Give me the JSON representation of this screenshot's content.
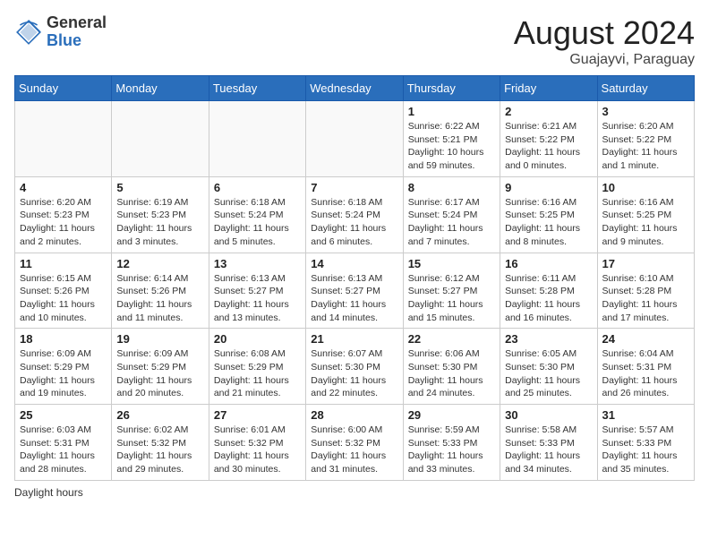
{
  "header": {
    "logo_general": "General",
    "logo_blue": "Blue",
    "month_year": "August 2024",
    "location": "Guajayvi, Paraguay"
  },
  "days_of_week": [
    "Sunday",
    "Monday",
    "Tuesday",
    "Wednesday",
    "Thursday",
    "Friday",
    "Saturday"
  ],
  "weeks": [
    [
      {
        "day": "",
        "info": ""
      },
      {
        "day": "",
        "info": ""
      },
      {
        "day": "",
        "info": ""
      },
      {
        "day": "",
        "info": ""
      },
      {
        "day": "1",
        "info": "Sunrise: 6:22 AM\nSunset: 5:21 PM\nDaylight: 10 hours and 59 minutes."
      },
      {
        "day": "2",
        "info": "Sunrise: 6:21 AM\nSunset: 5:22 PM\nDaylight: 11 hours and 0 minutes."
      },
      {
        "day": "3",
        "info": "Sunrise: 6:20 AM\nSunset: 5:22 PM\nDaylight: 11 hours and 1 minute."
      }
    ],
    [
      {
        "day": "4",
        "info": "Sunrise: 6:20 AM\nSunset: 5:23 PM\nDaylight: 11 hours and 2 minutes."
      },
      {
        "day": "5",
        "info": "Sunrise: 6:19 AM\nSunset: 5:23 PM\nDaylight: 11 hours and 3 minutes."
      },
      {
        "day": "6",
        "info": "Sunrise: 6:18 AM\nSunset: 5:24 PM\nDaylight: 11 hours and 5 minutes."
      },
      {
        "day": "7",
        "info": "Sunrise: 6:18 AM\nSunset: 5:24 PM\nDaylight: 11 hours and 6 minutes."
      },
      {
        "day": "8",
        "info": "Sunrise: 6:17 AM\nSunset: 5:24 PM\nDaylight: 11 hours and 7 minutes."
      },
      {
        "day": "9",
        "info": "Sunrise: 6:16 AM\nSunset: 5:25 PM\nDaylight: 11 hours and 8 minutes."
      },
      {
        "day": "10",
        "info": "Sunrise: 6:16 AM\nSunset: 5:25 PM\nDaylight: 11 hours and 9 minutes."
      }
    ],
    [
      {
        "day": "11",
        "info": "Sunrise: 6:15 AM\nSunset: 5:26 PM\nDaylight: 11 hours and 10 minutes."
      },
      {
        "day": "12",
        "info": "Sunrise: 6:14 AM\nSunset: 5:26 PM\nDaylight: 11 hours and 11 minutes."
      },
      {
        "day": "13",
        "info": "Sunrise: 6:13 AM\nSunset: 5:27 PM\nDaylight: 11 hours and 13 minutes."
      },
      {
        "day": "14",
        "info": "Sunrise: 6:13 AM\nSunset: 5:27 PM\nDaylight: 11 hours and 14 minutes."
      },
      {
        "day": "15",
        "info": "Sunrise: 6:12 AM\nSunset: 5:27 PM\nDaylight: 11 hours and 15 minutes."
      },
      {
        "day": "16",
        "info": "Sunrise: 6:11 AM\nSunset: 5:28 PM\nDaylight: 11 hours and 16 minutes."
      },
      {
        "day": "17",
        "info": "Sunrise: 6:10 AM\nSunset: 5:28 PM\nDaylight: 11 hours and 17 minutes."
      }
    ],
    [
      {
        "day": "18",
        "info": "Sunrise: 6:09 AM\nSunset: 5:29 PM\nDaylight: 11 hours and 19 minutes."
      },
      {
        "day": "19",
        "info": "Sunrise: 6:09 AM\nSunset: 5:29 PM\nDaylight: 11 hours and 20 minutes."
      },
      {
        "day": "20",
        "info": "Sunrise: 6:08 AM\nSunset: 5:29 PM\nDaylight: 11 hours and 21 minutes."
      },
      {
        "day": "21",
        "info": "Sunrise: 6:07 AM\nSunset: 5:30 PM\nDaylight: 11 hours and 22 minutes."
      },
      {
        "day": "22",
        "info": "Sunrise: 6:06 AM\nSunset: 5:30 PM\nDaylight: 11 hours and 24 minutes."
      },
      {
        "day": "23",
        "info": "Sunrise: 6:05 AM\nSunset: 5:30 PM\nDaylight: 11 hours and 25 minutes."
      },
      {
        "day": "24",
        "info": "Sunrise: 6:04 AM\nSunset: 5:31 PM\nDaylight: 11 hours and 26 minutes."
      }
    ],
    [
      {
        "day": "25",
        "info": "Sunrise: 6:03 AM\nSunset: 5:31 PM\nDaylight: 11 hours and 28 minutes."
      },
      {
        "day": "26",
        "info": "Sunrise: 6:02 AM\nSunset: 5:32 PM\nDaylight: 11 hours and 29 minutes."
      },
      {
        "day": "27",
        "info": "Sunrise: 6:01 AM\nSunset: 5:32 PM\nDaylight: 11 hours and 30 minutes."
      },
      {
        "day": "28",
        "info": "Sunrise: 6:00 AM\nSunset: 5:32 PM\nDaylight: 11 hours and 31 minutes."
      },
      {
        "day": "29",
        "info": "Sunrise: 5:59 AM\nSunset: 5:33 PM\nDaylight: 11 hours and 33 minutes."
      },
      {
        "day": "30",
        "info": "Sunrise: 5:58 AM\nSunset: 5:33 PM\nDaylight: 11 hours and 34 minutes."
      },
      {
        "day": "31",
        "info": "Sunrise: 5:57 AM\nSunset: 5:33 PM\nDaylight: 11 hours and 35 minutes."
      }
    ]
  ],
  "footer": {
    "note": "Daylight hours"
  }
}
